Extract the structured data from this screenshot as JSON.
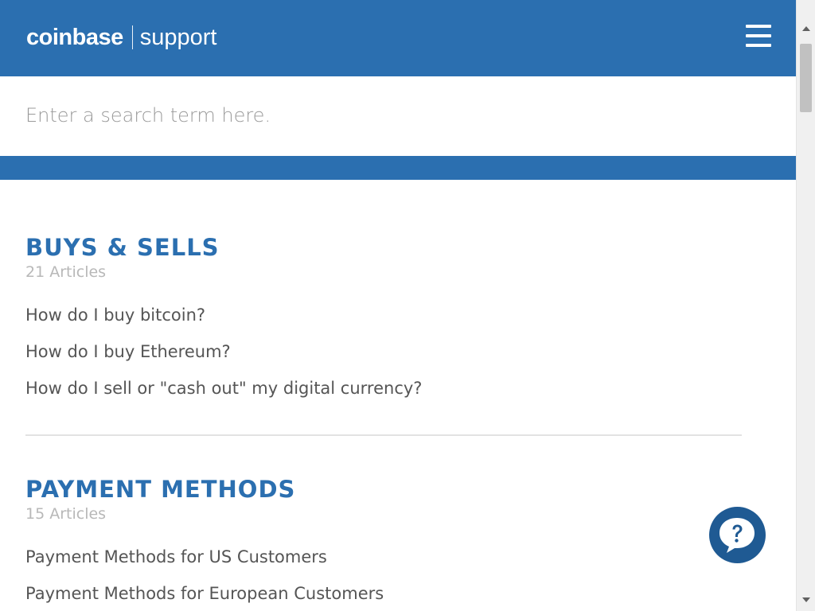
{
  "header": {
    "brand": "coinbase",
    "subtitle": "support",
    "menu_icon": "hamburger-menu-icon",
    "background_color": "#2b6fb0"
  },
  "search": {
    "placeholder": "Enter a search term here.",
    "value": ""
  },
  "sections": [
    {
      "title": "BUYS & SELLS",
      "count": "21 Articles",
      "articles": [
        "How do I buy bitcoin?",
        "How do I buy Ethereum?",
        "How do I sell or \"cash out\" my digital currency?"
      ]
    },
    {
      "title": "PAYMENT METHODS",
      "count": "15 Articles",
      "articles": [
        "Payment Methods for US Customers",
        "Payment Methods for European Customers"
      ]
    }
  ],
  "chat": {
    "icon": "help-chat-icon",
    "color": "#1f5a93"
  },
  "colors": {
    "accent": "#2b6fb0",
    "article_text": "#555555",
    "muted_text": "#b8b8b8"
  }
}
